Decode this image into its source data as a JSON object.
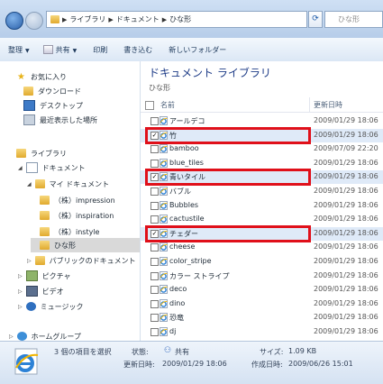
{
  "address": {
    "crumbs": [
      "ライブラリ",
      "ドキュメント",
      "ひな形"
    ],
    "search_placeholder": "ひな形"
  },
  "toolbar": {
    "organize": "整理",
    "share": "共有",
    "print": "印刷",
    "burn": "書き込む",
    "new_folder": "新しいフォルダー"
  },
  "nav": {
    "favorites": "お気に入り",
    "downloads": "ダウンロード",
    "desktop": "デスクトップ",
    "recent": "最近表示した場所",
    "libraries": "ライブラリ",
    "documents": "ドキュメント",
    "my_documents": "マイ ドキュメント",
    "folder_impression": "（株）impression",
    "folder_inspiration": "（株）inspiration",
    "folder_instyle": "（株）instyle",
    "folder_hinagata": "ひな形",
    "public_documents": "パブリックのドキュメント",
    "pictures": "ピクチャ",
    "videos": "ビデオ",
    "music": "ミュージック",
    "homegroup": "ホームグループ"
  },
  "content": {
    "title": "ドキュメント ライブラリ",
    "subtitle": "ひな形",
    "col_name": "名前",
    "col_date": "更新日時",
    "files": [
      {
        "name": "アールデコ",
        "date": "2009/01/29 18:06",
        "checked": false
      },
      {
        "name": "竹",
        "date": "2009/01/29 18:06",
        "checked": true
      },
      {
        "name": "bamboo",
        "date": "2009/07/09 22:20",
        "checked": false
      },
      {
        "name": "blue_tiles",
        "date": "2009/01/29 18:06",
        "checked": false
      },
      {
        "name": "青いタイル",
        "date": "2009/01/29 18:06",
        "checked": true
      },
      {
        "name": "バブル",
        "date": "2009/01/29 18:06",
        "checked": false
      },
      {
        "name": "Bubbles",
        "date": "2009/01/29 18:06",
        "checked": false
      },
      {
        "name": "cactustile",
        "date": "2009/01/29 18:06",
        "checked": false
      },
      {
        "name": "チェダー",
        "date": "2009/01/29 18:06",
        "checked": true
      },
      {
        "name": "cheese",
        "date": "2009/01/29 18:06",
        "checked": false
      },
      {
        "name": "color_stripe",
        "date": "2009/01/29 18:06",
        "checked": false
      },
      {
        "name": "カラー ストライプ",
        "date": "2009/01/29 18:06",
        "checked": false
      },
      {
        "name": "deco",
        "date": "2009/01/29 18:06",
        "checked": false
      },
      {
        "name": "dino",
        "date": "2009/01/29 18:06",
        "checked": false
      },
      {
        "name": "恐竜",
        "date": "2009/01/29 18:06",
        "checked": false
      },
      {
        "name": "dj",
        "date": "2009/01/29 18:06",
        "checked": false
      }
    ]
  },
  "status": {
    "selection": "3 個の項目を選択",
    "state_label": "状態:",
    "state_value": "共有",
    "size_label": "サイズ:",
    "size_value": "1.09 KB",
    "modified_label": "更新日時:",
    "modified_value": "2009/01/29 18:06",
    "created_label": "作成日時:",
    "created_value": "2009/06/26 15:01"
  },
  "colors": {
    "highlight_box": "#e0101a",
    "title_blue": "#1f3d88"
  }
}
